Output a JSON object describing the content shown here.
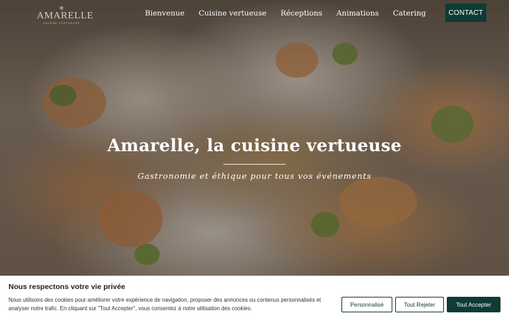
{
  "brand": {
    "name": "AMARELLE",
    "tagline": "CUISINE VERTUEUSE",
    "mark": "❀"
  },
  "nav": {
    "items": [
      {
        "label": "Bienvenue"
      },
      {
        "label": "Cuisine vertueuse"
      },
      {
        "label": "Réceptions"
      },
      {
        "label": "Animations"
      },
      {
        "label": "Catering"
      }
    ],
    "contact_label": "CONTACT"
  },
  "hero": {
    "title": "Amarelle, la cuisine vertueuse",
    "subtitle": "Gastronomie et éthique pour tous vos événements"
  },
  "cookie_banner": {
    "title": "Nous respectons votre vie privée",
    "text": "Nous utilisons des cookies pour améliorer votre expérience de navigation, proposer des annonces ou contenus personnalisés et analyser notre trafic. En cliquant sur \"Tout Accepter\", vous consentez à notre utilisation des cookies.",
    "buttons": {
      "customize": "Personnalisé",
      "reject": "Tout Rejeter",
      "accept": "Tout Accepter"
    }
  },
  "colors": {
    "accent": "#0f3b35",
    "logo": "#d8cdb8"
  }
}
